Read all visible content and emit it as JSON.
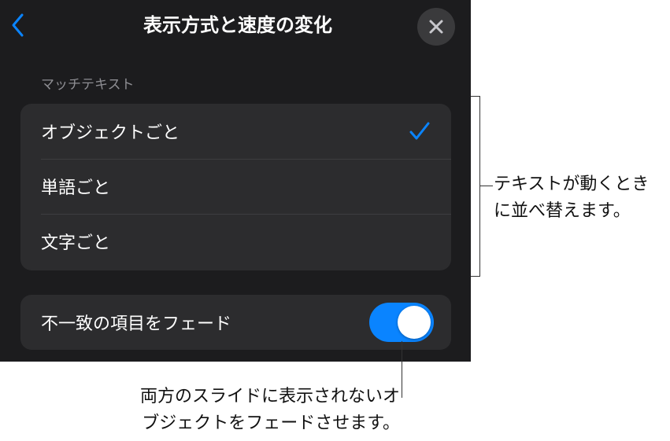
{
  "header": {
    "title": "表示方式と速度の変化",
    "back_icon": "chevron-left-icon",
    "close_icon": "close-icon"
  },
  "section": {
    "label": "マッチテキスト",
    "options": [
      {
        "label": "オブジェクトごと",
        "selected": true
      },
      {
        "label": "単語ごと",
        "selected": false
      },
      {
        "label": "文字ごと",
        "selected": false
      }
    ]
  },
  "fade_toggle": {
    "label": "不一致の項目をフェード",
    "on": true
  },
  "callouts": {
    "right_line1": "テキストが動くとき",
    "right_line2": "に並べ替えます。",
    "bottom_line1": "両方のスライドに表示されないオ",
    "bottom_line2": "ブジェクトをフェードさせます。"
  },
  "colors": {
    "panel_bg": "#1c1c1e",
    "row_bg": "#2c2c2e",
    "accent": "#0a84ff"
  }
}
